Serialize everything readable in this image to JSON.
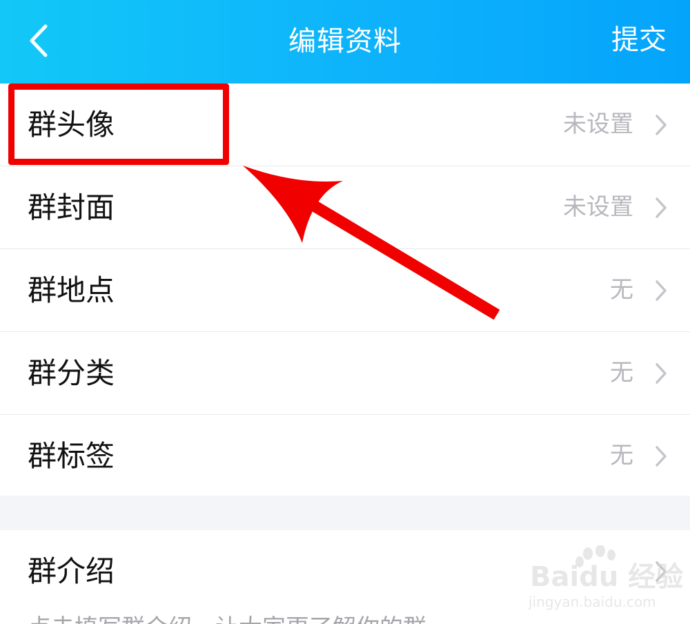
{
  "header": {
    "title": "编辑资料",
    "submit_label": "提交"
  },
  "rows": [
    {
      "label": "群头像",
      "value": "未设置"
    },
    {
      "label": "群封面",
      "value": "未设置"
    },
    {
      "label": "群地点",
      "value": "无"
    },
    {
      "label": "群分类",
      "value": "无"
    },
    {
      "label": "群标签",
      "value": "无"
    }
  ],
  "intro": {
    "label": "群介绍",
    "hint": "点击填写群介绍，让大家更了解你的群"
  },
  "watermark": {
    "word": "Baidu 经验",
    "url": "jingyan.baidu.com"
  },
  "colors": {
    "nav_gradient_start": "#12c8f8",
    "nav_gradient_end": "#04a4fb",
    "annotation_red": "#f10000",
    "value_gray": "#b7b7bd"
  }
}
